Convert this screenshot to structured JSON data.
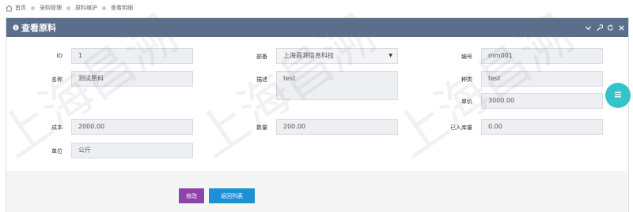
{
  "breadcrumb": {
    "items": [
      "首页",
      "采购管理",
      "原料维护",
      "查看明细"
    ]
  },
  "panel": {
    "title": "查看原料"
  },
  "fields": {
    "id": {
      "label": "ID",
      "value": "1"
    },
    "supplier": {
      "label": "部备",
      "value": "上海昌溯信息科技"
    },
    "code": {
      "label": "编号",
      "value": "mm001"
    },
    "name": {
      "label": "名称",
      "value": "测试原料"
    },
    "description": {
      "label": "描述",
      "value": "test"
    },
    "category": {
      "label": "种类",
      "value": "test"
    },
    "unit_price": {
      "label": "单价",
      "value": "3000.00"
    },
    "cost": {
      "label": "成本",
      "value": "2000.00"
    },
    "quantity": {
      "label": "数量",
      "value": "200.00"
    },
    "stocked": {
      "label": "已入库量",
      "value": "0.00"
    },
    "unit": {
      "label": "单位",
      "value": "公斤"
    }
  },
  "buttons": {
    "edit": "修改",
    "back": "返回列表"
  },
  "watermark": "上海昌溯",
  "colors": {
    "header": "#5b6e8c",
    "edit_button": "#8e44ad",
    "back_button": "#1e90d6",
    "float_button": "#33c3c8"
  }
}
